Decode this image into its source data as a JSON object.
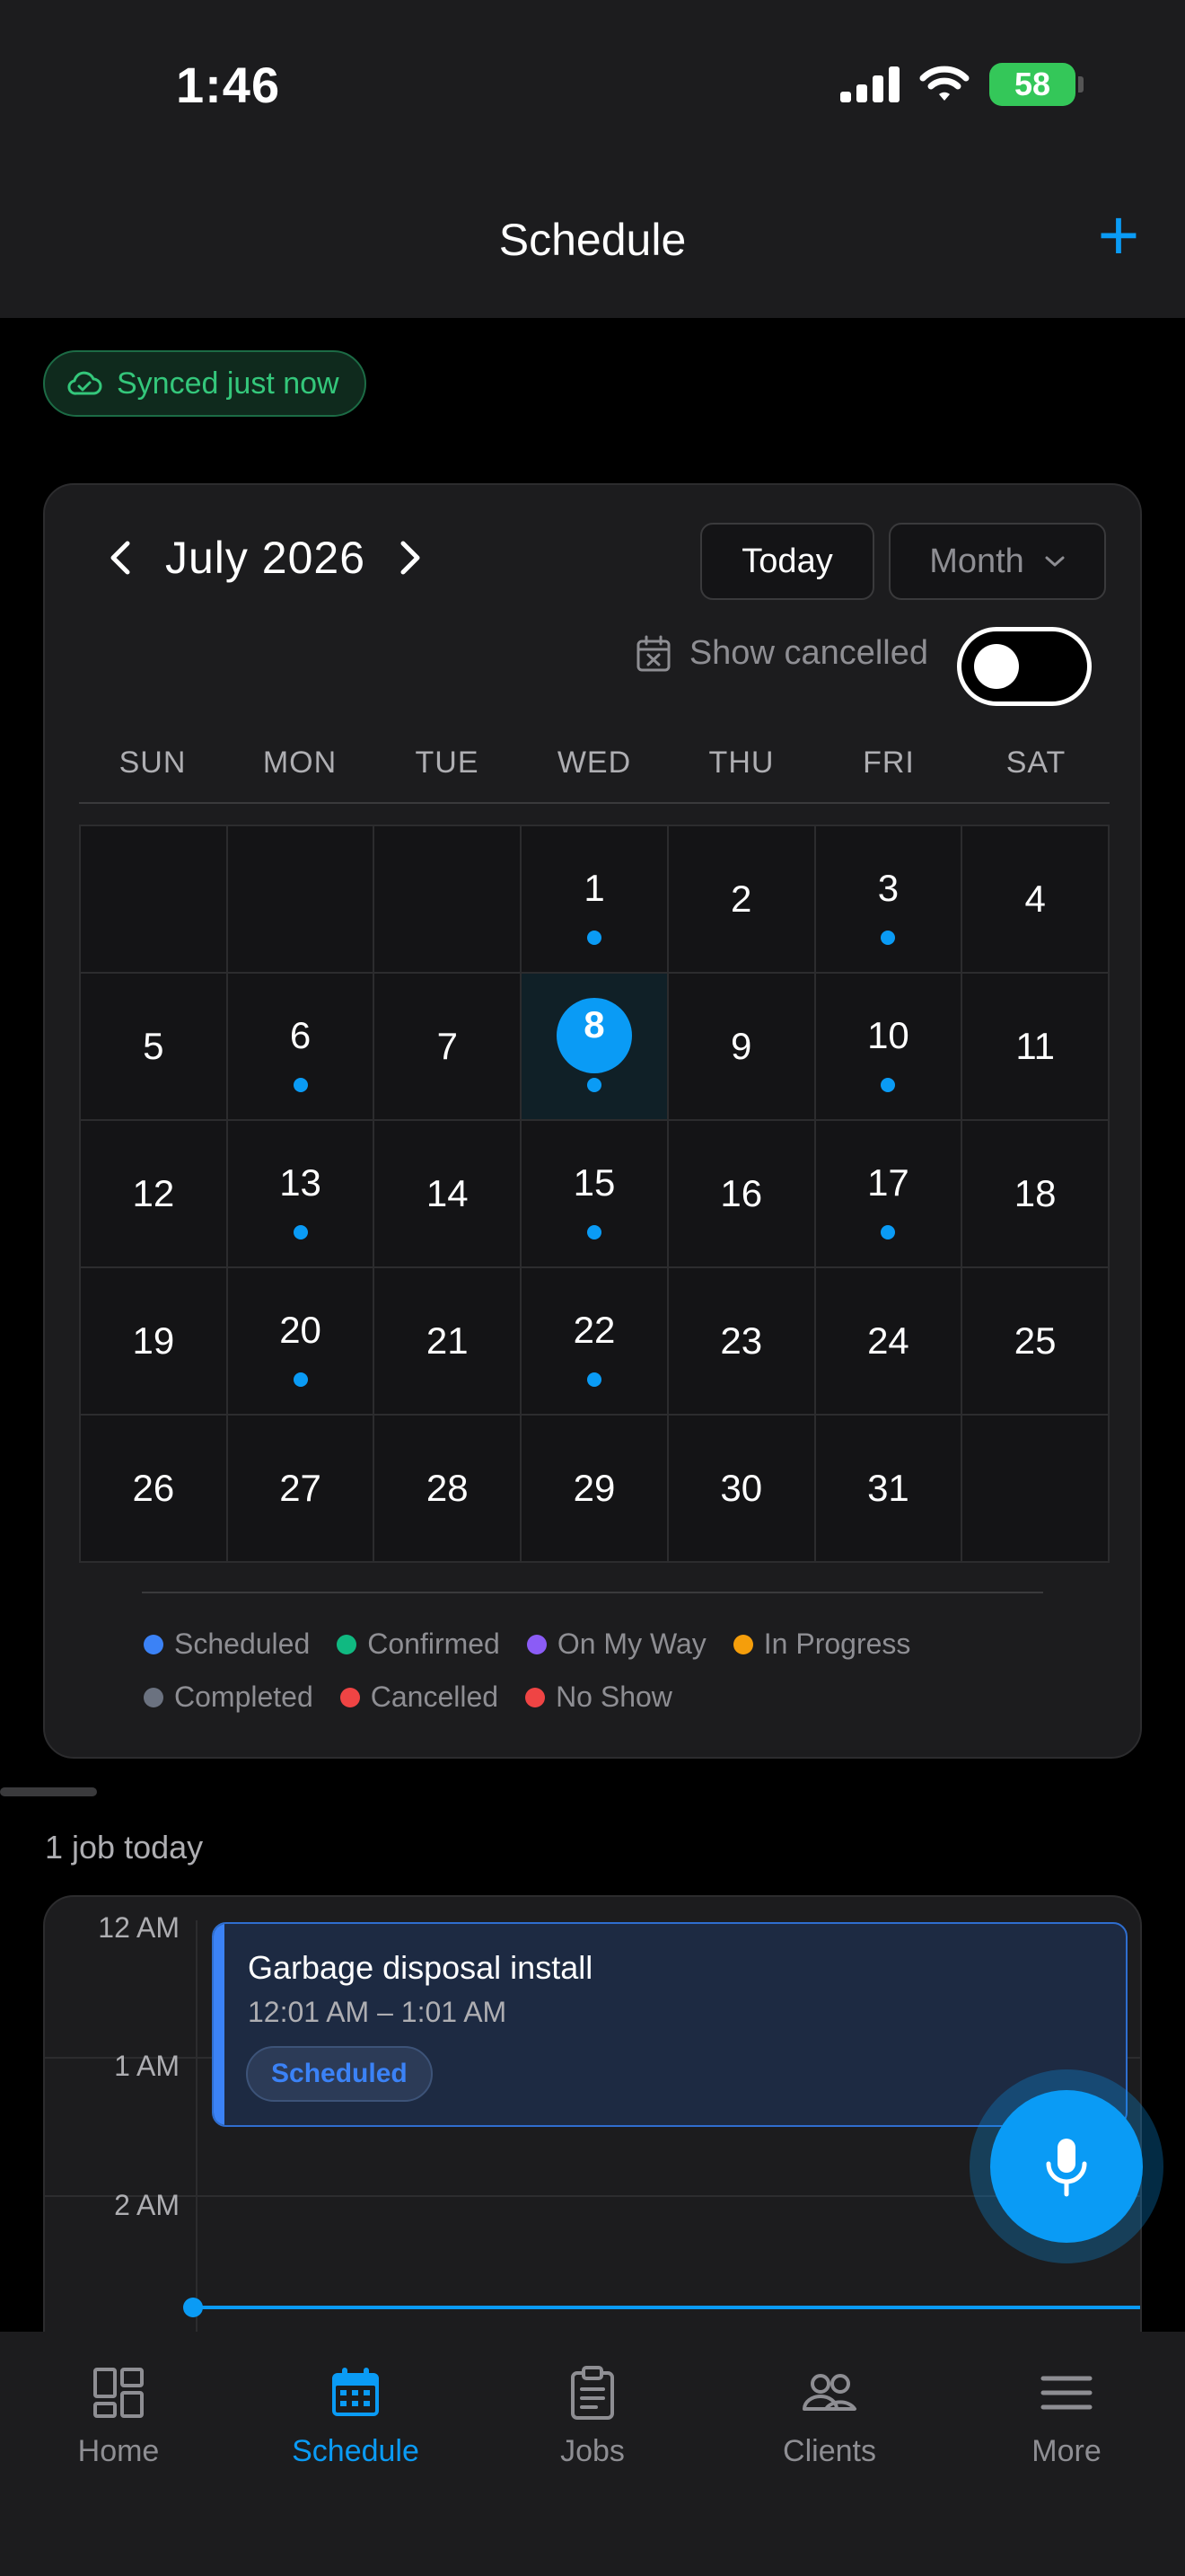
{
  "status_bar": {
    "time": "1:46",
    "battery": "58"
  },
  "header": {
    "title": "Schedule",
    "add_label": "+"
  },
  "sync": {
    "label": "Synced just now"
  },
  "calendar": {
    "month_label": "July 2026",
    "today_label": "Today",
    "view_label": "Month",
    "show_cancelled_label": "Show cancelled",
    "show_cancelled_on": false,
    "weekdays": [
      "SUN",
      "MON",
      "TUE",
      "WED",
      "THU",
      "FRI",
      "SAT"
    ],
    "days": [
      {
        "n": ""
      },
      {
        "n": ""
      },
      {
        "n": ""
      },
      {
        "n": "1",
        "dot": true
      },
      {
        "n": "2"
      },
      {
        "n": "3",
        "dot": true
      },
      {
        "n": "4"
      },
      {
        "n": "5"
      },
      {
        "n": "6",
        "dot": true
      },
      {
        "n": "7"
      },
      {
        "n": "8",
        "dot": true,
        "today": true
      },
      {
        "n": "9"
      },
      {
        "n": "10",
        "dot": true
      },
      {
        "n": "11"
      },
      {
        "n": "12"
      },
      {
        "n": "13",
        "dot": true
      },
      {
        "n": "14"
      },
      {
        "n": "15",
        "dot": true
      },
      {
        "n": "16"
      },
      {
        "n": "17",
        "dot": true
      },
      {
        "n": "18"
      },
      {
        "n": "19"
      },
      {
        "n": "20",
        "dot": true
      },
      {
        "n": "21"
      },
      {
        "n": "22",
        "dot": true
      },
      {
        "n": "23"
      },
      {
        "n": "24"
      },
      {
        "n": "25"
      },
      {
        "n": "26"
      },
      {
        "n": "27"
      },
      {
        "n": "28"
      },
      {
        "n": "29"
      },
      {
        "n": "30"
      },
      {
        "n": "31"
      },
      {
        "n": ""
      }
    ],
    "dot_color": "#0a9bf5",
    "legend": [
      {
        "label": "Scheduled",
        "color": "#3b82f6"
      },
      {
        "label": "Confirmed",
        "color": "#10b981"
      },
      {
        "label": "On My Way",
        "color": "#8b5cf6"
      },
      {
        "label": "In Progress",
        "color": "#f59e0b"
      },
      {
        "label": "Completed",
        "color": "#6b7280"
      },
      {
        "label": "Cancelled",
        "color": "#ef4444"
      },
      {
        "label": "No Show",
        "color": "#ef4444"
      }
    ]
  },
  "day_view": {
    "jobs_count_label": "1 job today",
    "hours": [
      "12 AM",
      "1 AM",
      "2 AM"
    ],
    "event": {
      "title": "Garbage disposal install",
      "time": "12:01 AM – 1:01 AM",
      "status": "Scheduled"
    }
  },
  "tabs": [
    {
      "label": "Home",
      "icon": "home-icon",
      "active": false
    },
    {
      "label": "Schedule",
      "icon": "calendar-icon",
      "active": true
    },
    {
      "label": "Jobs",
      "icon": "clipboard-icon",
      "active": false
    },
    {
      "label": "Clients",
      "icon": "users-icon",
      "active": false
    },
    {
      "label": "More",
      "icon": "menu-icon",
      "active": false
    }
  ],
  "colors": {
    "accent": "#0a9bf5",
    "success": "#34c77b"
  }
}
